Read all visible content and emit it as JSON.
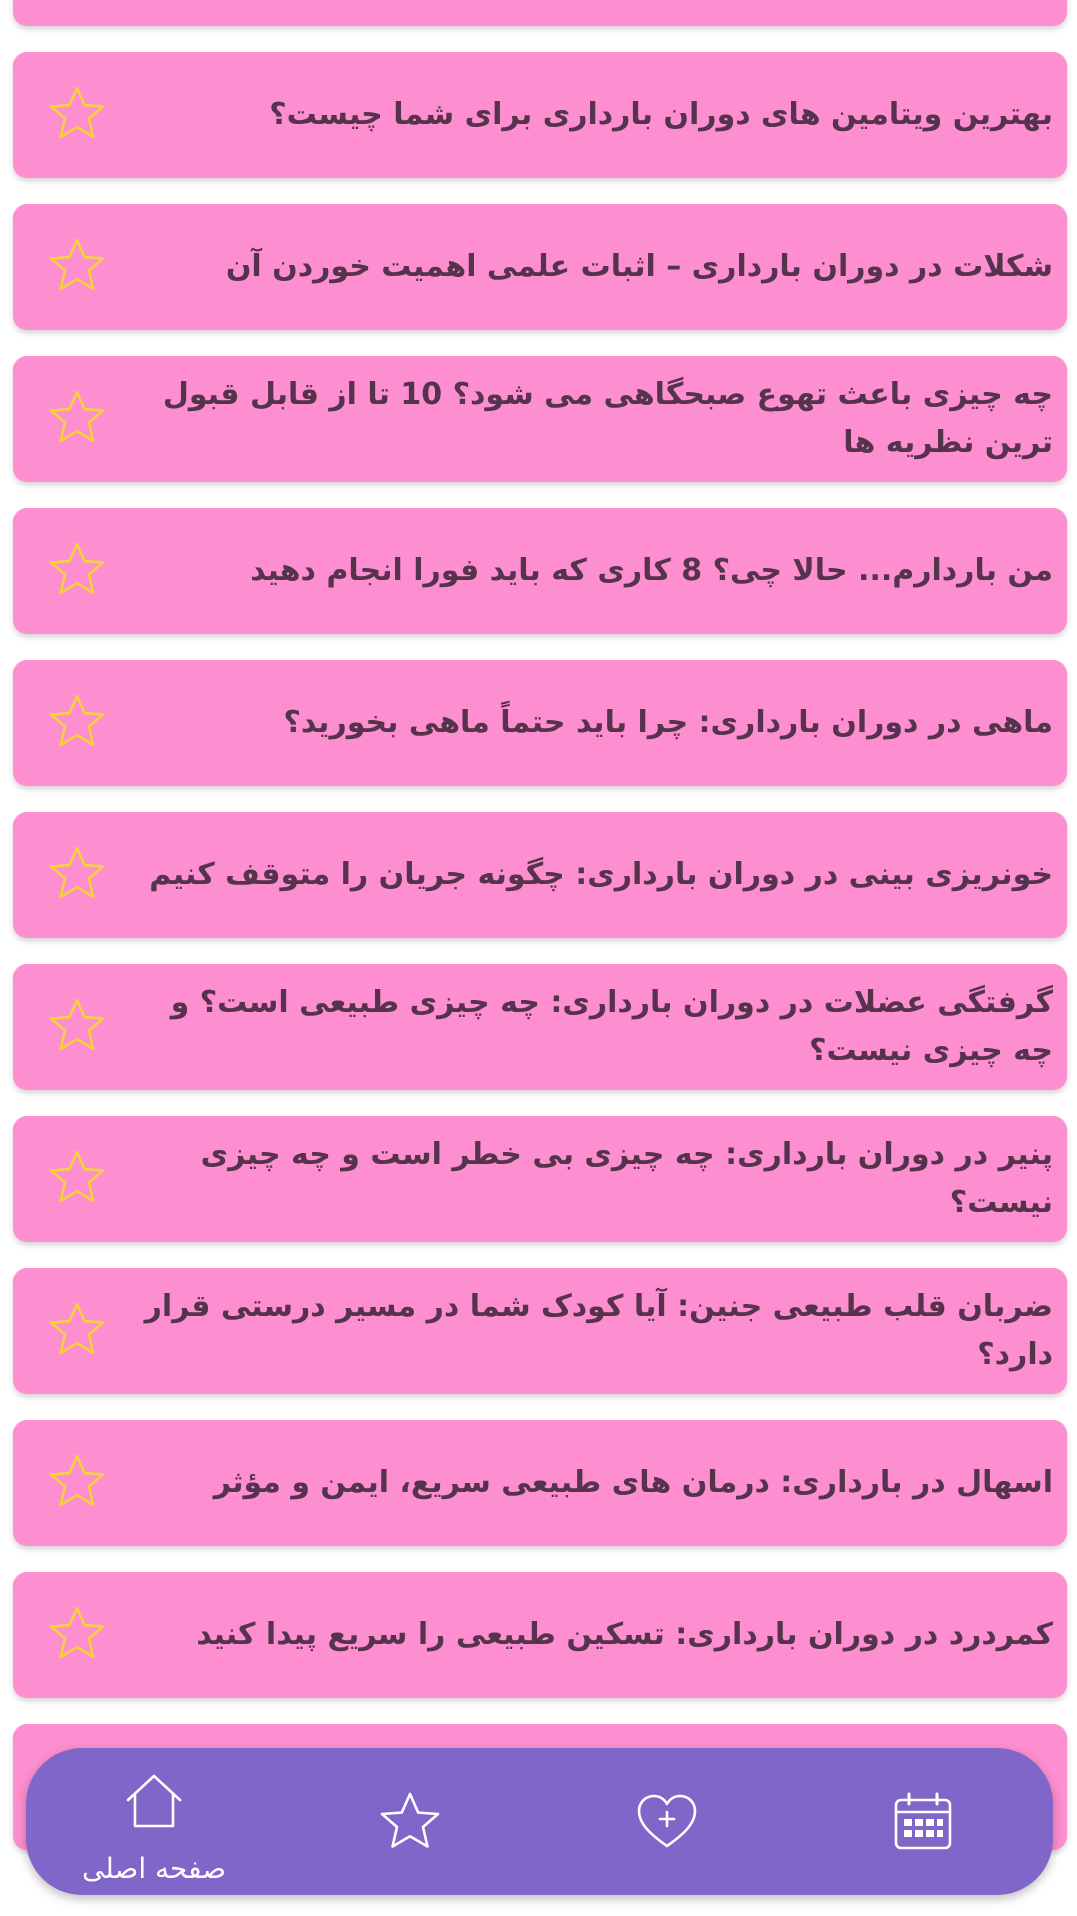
{
  "articles": [
    {
      "title": ""
    },
    {
      "title": "بهترین ویتامین های دوران بارداری برای شما چیست؟"
    },
    {
      "title": "شکلات در دوران بارداری – اثبات علمی اهمیت خوردن آن"
    },
    {
      "title": "چه چیزی باعث تهوع صبحگاهی می شود؟ 10 تا از قابل قبول ترین نظریه ها"
    },
    {
      "title": "من باردارم... حالا چی؟ 8 کاری که باید فورا انجام دهید"
    },
    {
      "title": "ماهی در دوران بارداری: چرا باید حتماً ماهی بخورید؟"
    },
    {
      "title": "خونریزی بینی در دوران بارداری: چگونه جریان را متوقف کنیم"
    },
    {
      "title": "گرفتگی عضلات در دوران بارداری: چه چیزی طبیعی است؟ و چه چیزی نیست؟"
    },
    {
      "title": "پنیر در دوران بارداری: چه چیزی بی خطر است و چه چیزی نیست؟"
    },
    {
      "title": "ضربان قلب طبیعی جنین: آیا کودک شما در مسیر درستی قرار دارد؟"
    },
    {
      "title": "اسهال در بارداری: درمان های طبیعی سریع، ایمن و مؤثر"
    },
    {
      "title": "کمردرد در دوران بارداری: تسکین طبیعی را سریع پیدا کنید"
    },
    {
      "title": ""
    }
  ],
  "nav": {
    "home_label": "صفحه اصلی",
    "home_icon": "home-icon",
    "favorites_icon": "star-icon",
    "health_icon": "heart-plus-icon",
    "calendar_icon": "calendar-icon"
  },
  "colors": {
    "card": "#fd8ecf",
    "card_text": "#55334c",
    "star_outline": "#f5d23c",
    "nav_bg": "#8066c8",
    "nav_fg": "#ffffff"
  }
}
